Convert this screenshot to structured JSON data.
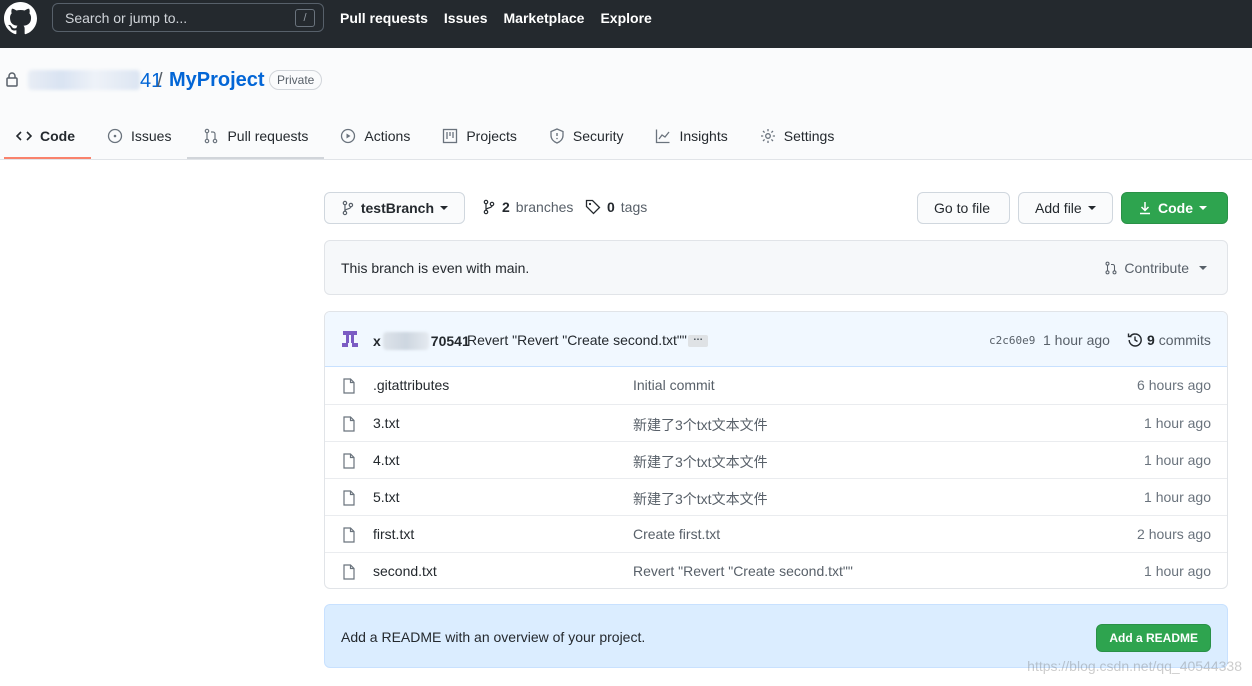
{
  "header": {
    "search_placeholder": "Search or jump to...",
    "search_shortcut": "/",
    "nav": [
      "Pull requests",
      "Issues",
      "Marketplace",
      "Explore"
    ]
  },
  "repo": {
    "owner_visible": "41",
    "separator": "/",
    "name": "MyProject",
    "visibility": "Private"
  },
  "tabs": [
    {
      "label": "Code",
      "icon": "code-icon"
    },
    {
      "label": "Issues",
      "icon": "issue-icon"
    },
    {
      "label": "Pull requests",
      "icon": "pull-request-icon"
    },
    {
      "label": "Actions",
      "icon": "play-icon"
    },
    {
      "label": "Projects",
      "icon": "project-icon"
    },
    {
      "label": "Security",
      "icon": "shield-icon"
    },
    {
      "label": "Insights",
      "icon": "graph-icon"
    },
    {
      "label": "Settings",
      "icon": "gear-icon"
    }
  ],
  "branch_bar": {
    "current_branch": "testBranch",
    "branches_count": "2",
    "branches_label": "branches",
    "tags_count": "0",
    "tags_label": "tags",
    "go_to_file": "Go to file",
    "add_file": "Add file",
    "code": "Code"
  },
  "branch_status": {
    "message": "This branch is even with main.",
    "contribute": "Contribute"
  },
  "latest_commit": {
    "author_prefix": "x",
    "author_suffix": "70541",
    "message": "Revert \"Revert \"Create second.txt\"\"",
    "ellipsis": "…",
    "sha": "c2c60e9",
    "time": "1 hour ago",
    "commits_count": "9",
    "commits_label": "commits"
  },
  "files": [
    {
      "name": ".gitattributes",
      "message": "Initial commit",
      "age": "6 hours ago"
    },
    {
      "name": "3.txt",
      "message": "新建了3个txt文本文件",
      "age": "1 hour ago"
    },
    {
      "name": "4.txt",
      "message": "新建了3个txt文本文件",
      "age": "1 hour ago"
    },
    {
      "name": "5.txt",
      "message": "新建了3个txt文本文件",
      "age": "1 hour ago"
    },
    {
      "name": "first.txt",
      "message": "Create first.txt",
      "age": "2 hours ago"
    },
    {
      "name": "second.txt",
      "message": "Revert \"Revert \"Create second.txt\"\"",
      "age": "1 hour ago"
    }
  ],
  "readme": {
    "message": "Add a README with an overview of your project.",
    "button": "Add a README"
  },
  "watermark": "https://blog.csdn.net/qq_40544338",
  "colors": {
    "header_bg": "#24292e",
    "link_blue": "#0366d6",
    "green_button": "#2ea44f",
    "tab_underline": "#f9826c",
    "commit_header_bg": "#f1f8ff",
    "readme_bg": "#dbedff"
  }
}
